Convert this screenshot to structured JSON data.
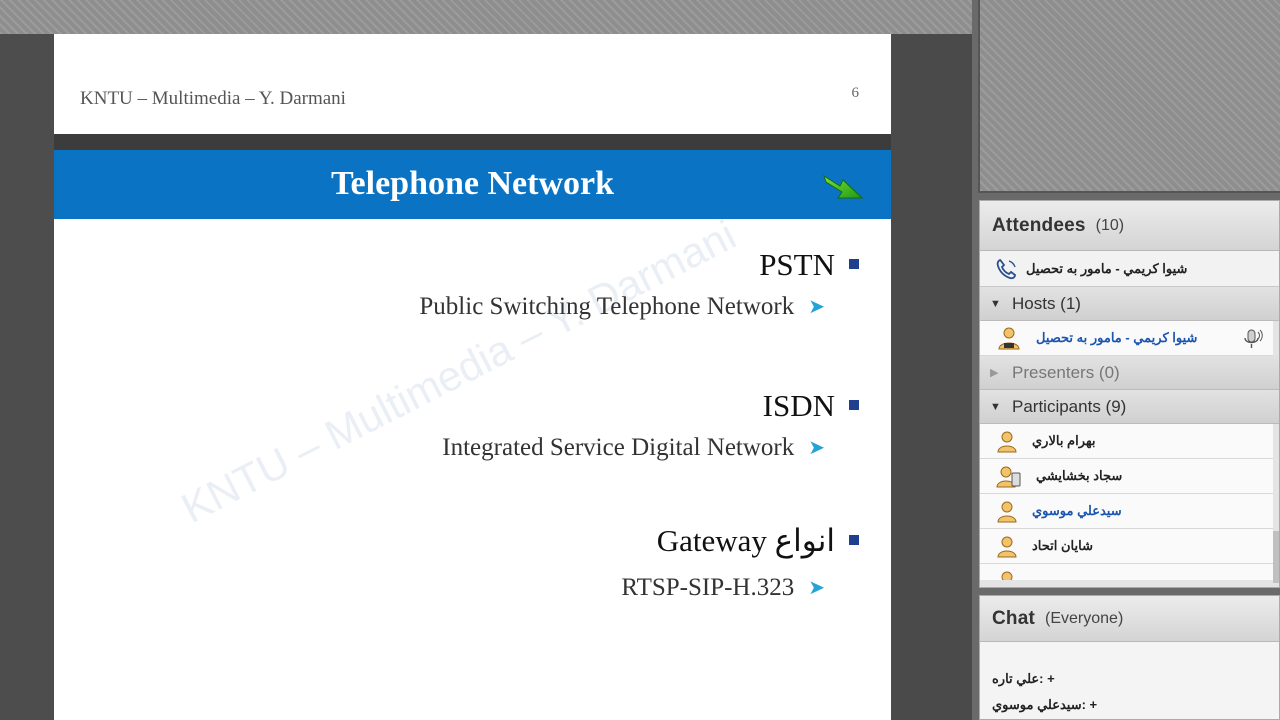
{
  "slide": {
    "footer": "KNTU – Multimedia – Y. Darmani",
    "page_number": "6",
    "title": "Telephone Network",
    "watermark": "KNTU – Multimedia – Y. Darmani",
    "bullets": [
      {
        "main": "PSTN",
        "sub": "Public Switching Telephone Network"
      },
      {
        "main": "ISDN",
        "sub": "Integrated Service Digital Network"
      },
      {
        "main": "انواع Gateway",
        "sub": "RTSP-SIP-H.323"
      }
    ]
  },
  "attendees": {
    "title": "Attendees",
    "count": "(10)",
    "me": "شيوا كريمي - مامور به تحصيل",
    "groups": {
      "hosts": {
        "label": "Hosts (1)",
        "users": [
          "شيوا كريمي - مامور به تحصيل"
        ]
      },
      "presenters": {
        "label": "Presenters (0)"
      },
      "participants": {
        "label": "Participants (9)",
        "users": [
          "بهرام بالاري",
          "سجاد بخشايشي",
          "سيدعلي موسوي",
          "شايان اتحاد"
        ]
      }
    }
  },
  "chat": {
    "title": "Chat",
    "scope": "(Everyone)",
    "messages": [
      "+ :علي تاره",
      "+ :سيدعلي موسوي"
    ]
  },
  "colors": {
    "title_bar": "#0a73c4",
    "bullet_square": "#1f3f8f",
    "sub_arrow": "#23a3d6",
    "blue_name": "#1c55b0"
  }
}
